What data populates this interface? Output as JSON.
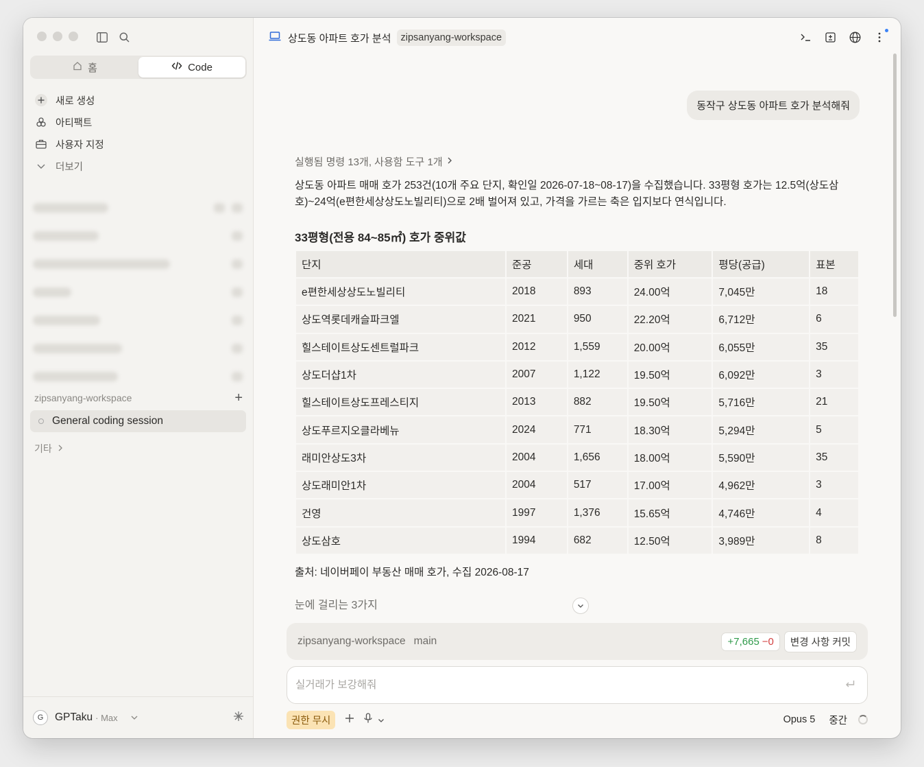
{
  "sidebar": {
    "tabs": [
      {
        "label": "홈",
        "icon": "home-icon"
      },
      {
        "label": "Code",
        "icon": "code-icon"
      }
    ],
    "nav": [
      {
        "label": "새로 생성",
        "icon": "plus-icon"
      },
      {
        "label": "아티팩트",
        "icon": "artifact-icon"
      },
      {
        "label": "사용자 지정",
        "icon": "briefcase-icon"
      },
      {
        "label": "더보기",
        "icon": "chevron-down-icon"
      }
    ],
    "workspace_header": "zipsanyang-workspace",
    "workspace_item": "General coding session",
    "other_label": "기타",
    "user": {
      "avatar": "G",
      "name": "GPTaku",
      "plan": "· Max"
    }
  },
  "topbar": {
    "title": "상도동 아파트 호가 분석",
    "workspace_badge": "zipsanyang-workspace"
  },
  "conversation": {
    "user_message": "동작구 상도동 아파트 호가 분석해줘",
    "exec_summary": "실행됨 명령 13개, 사용함 도구 1개",
    "summary": "상도동 아파트 매매 호가 253건(10개 주요 단지, 확인일 2026-07-18~08-17)을 수집했습니다. 33평형 호가는 12.5억(상도삼호)~24억(e편한세상상도노빌리티)으로 2배 벌어져 있고, 가격을 가르는 축은 입지보다 연식입니다.",
    "section_title": "33평형(전용 84~85㎡) 호가 중위값",
    "table": {
      "headers": [
        "단지",
        "준공",
        "세대",
        "중위 호가",
        "평당(공급)",
        "표본"
      ],
      "rows": [
        [
          "e편한세상상도노빌리티",
          "2018",
          "893",
          "24.00억",
          "7,045만",
          "18"
        ],
        [
          "상도역롯데캐슬파크엘",
          "2021",
          "950",
          "22.20억",
          "6,712만",
          "6"
        ],
        [
          "힐스테이트상도센트럴파크",
          "2012",
          "1,559",
          "20.00억",
          "6,055만",
          "35"
        ],
        [
          "상도더샵1차",
          "2007",
          "1,122",
          "19.50억",
          "6,092만",
          "3"
        ],
        [
          "힐스테이트상도프레스티지",
          "2013",
          "882",
          "19.50억",
          "5,716만",
          "21"
        ],
        [
          "상도푸르지오클라베뉴",
          "2024",
          "771",
          "18.30억",
          "5,294만",
          "5"
        ],
        [
          "래미안상도3차",
          "2004",
          "1,656",
          "18.00억",
          "5,590만",
          "35"
        ],
        [
          "상도래미안1차",
          "2004",
          "517",
          "17.00억",
          "4,962만",
          "3"
        ],
        [
          "건영",
          "1997",
          "1,376",
          "15.65억",
          "4,746만",
          "4"
        ],
        [
          "상도삼호",
          "1994",
          "682",
          "12.50억",
          "3,989만",
          "8"
        ]
      ]
    },
    "source": "출처: 네이버페이 부동산 매매 호가, 수집 2026-08-17",
    "notice_title": "눈에 걸리는 3가지"
  },
  "status": {
    "workspace": "zipsanyang-workspace",
    "branch": "main",
    "additions": "+7,665",
    "deletions": "−0",
    "commit_label": "변경 사항 커밋"
  },
  "composer": {
    "placeholder": "실거래가 보강해줘"
  },
  "footer": {
    "permission": "권한 무시",
    "model": "Opus 5",
    "effort": "중간"
  }
}
